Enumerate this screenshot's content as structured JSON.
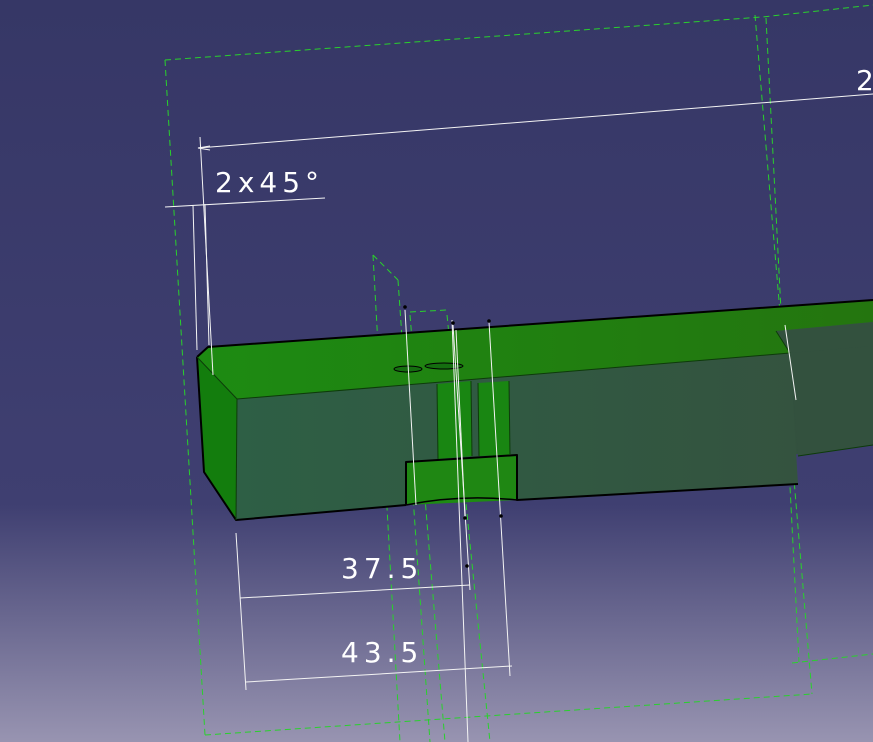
{
  "viewport": {
    "background_top": "#363766",
    "background_mid": "#403f70",
    "background_bottom": "#9894b1"
  },
  "part": {
    "top_face_color": "#1f7f12",
    "front_face_color": "#345646",
    "side_face_color": "#158b10",
    "edge_color": "#000000"
  },
  "dimensions": {
    "chamfer_label": "2x45°",
    "dim_37_5": "37.5",
    "dim_43_5": "43.5",
    "overall_partial": "2"
  },
  "colors": {
    "dimension_text": "#ffffff",
    "construction_lines": "#29d12c"
  }
}
